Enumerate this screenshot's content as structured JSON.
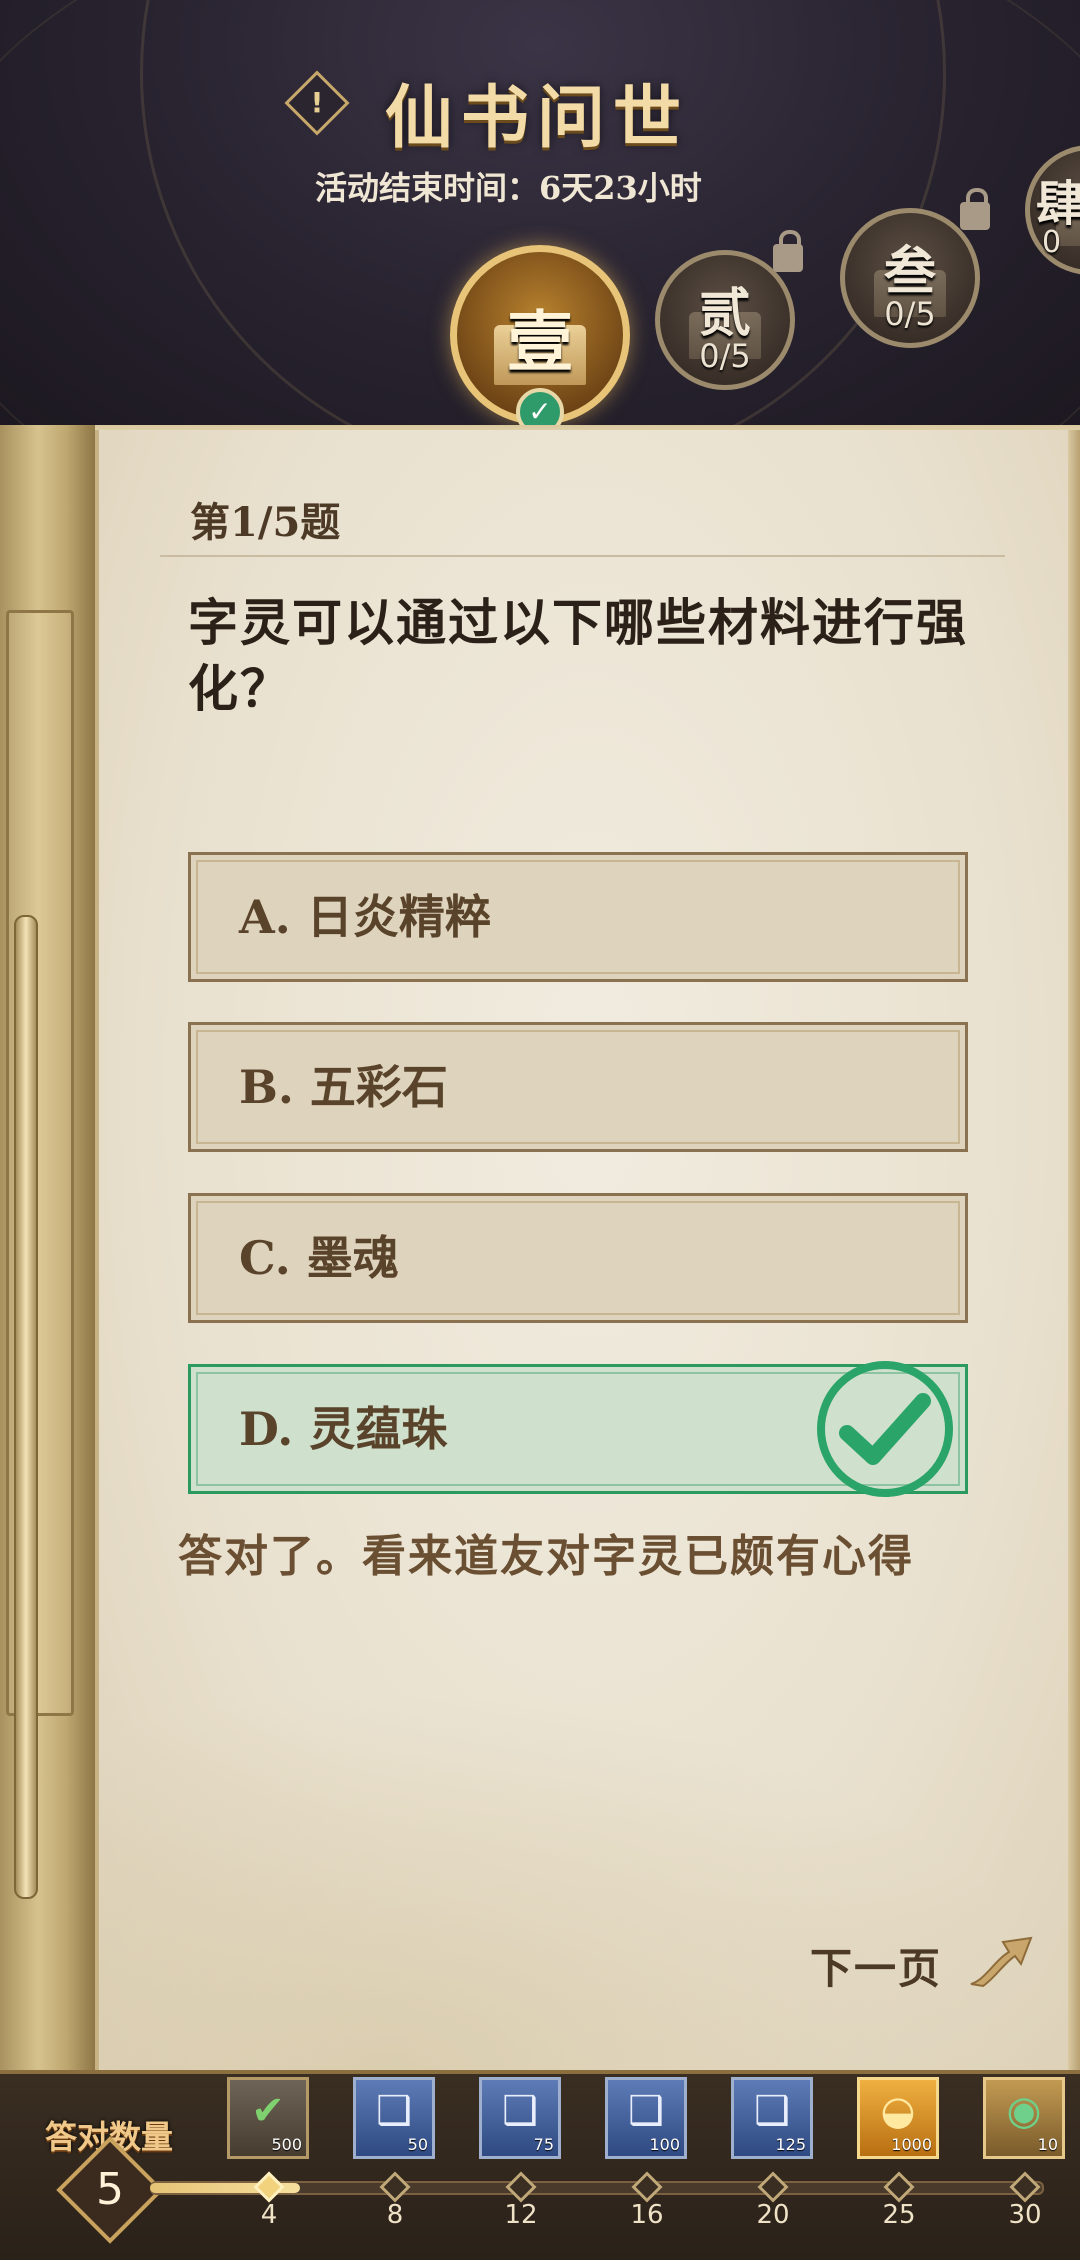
{
  "header": {
    "title": "仙书问世",
    "timer": "活动结束时间：6天23小时",
    "warn_glyph": "!"
  },
  "chapters": [
    {
      "num": "壹",
      "progress": "",
      "state": "active",
      "completed": true
    },
    {
      "num": "贰",
      "progress": "0/5",
      "state": "locked"
    },
    {
      "num": "叁",
      "progress": "0/5",
      "state": "locked"
    },
    {
      "num": "肆",
      "progress": "0",
      "state": "locked"
    }
  ],
  "quiz": {
    "question_number": "第1/5题",
    "question": "字灵可以通过以下哪些材料进行强化？",
    "options": [
      {
        "label": "A. 日炎精粹",
        "correct": false
      },
      {
        "label": "B. 五彩石",
        "correct": false
      },
      {
        "label": "C. 墨魂",
        "correct": false
      },
      {
        "label": "D. 灵蕴珠",
        "correct": true
      }
    ],
    "feedback": "答对了。看来道友对字灵已颇有心得",
    "next_label": "下一页"
  },
  "rewards_bar": {
    "label": "答对数量",
    "count": "5",
    "milestones": [
      "4",
      "8",
      "12",
      "16",
      "20",
      "25",
      "30"
    ],
    "reached_index": 0,
    "rewards": [
      {
        "icon": "stone-check-icon",
        "amount": "500",
        "style": "gray"
      },
      {
        "icon": "scroll-icon",
        "amount": "50",
        "style": "blue"
      },
      {
        "icon": "scroll-icon",
        "amount": "75",
        "style": "blue"
      },
      {
        "icon": "scroll-icon",
        "amount": "100",
        "style": "blue"
      },
      {
        "icon": "scroll-icon",
        "amount": "125",
        "style": "blue"
      },
      {
        "icon": "gold-ingot-icon",
        "amount": "1000",
        "style": "gold"
      },
      {
        "icon": "jade-dragon-icon",
        "amount": "10",
        "style": "green"
      }
    ]
  },
  "colors": {
    "correct_green": "#2aa468",
    "gold_accent": "#e8c478"
  }
}
